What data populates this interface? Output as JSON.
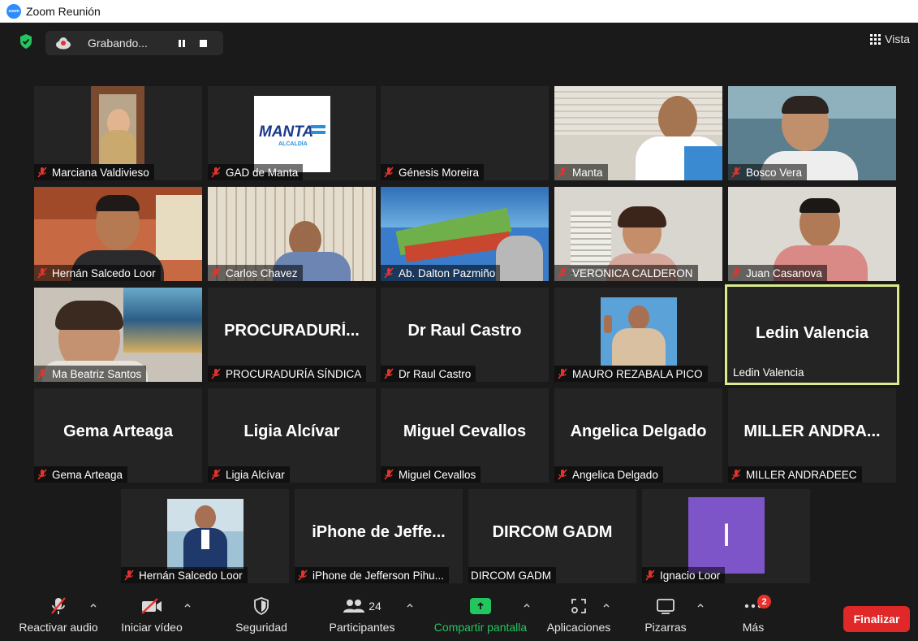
{
  "window": {
    "title": "Zoom Reunión",
    "logo_text": "zoom"
  },
  "recording": {
    "status": "Grabando..."
  },
  "view_button": {
    "label": "Vista"
  },
  "tiles": [
    {
      "label": "Marciana Valdivieso",
      "muted": true
    },
    {
      "label": "GAD de Manta",
      "muted": true,
      "logo_main": "MANTA",
      "logo_sub": "ALCALDÍA"
    },
    {
      "label": "Génesis Moreira",
      "muted": true
    },
    {
      "label": "Manta",
      "muted": true
    },
    {
      "label": "Bosco Vera",
      "muted": true
    },
    {
      "label": "Hernán Salcedo Loor",
      "muted": true
    },
    {
      "label": "Carlos Chavez",
      "muted": true
    },
    {
      "label": "Ab. Dalton Pazmiño",
      "muted": true
    },
    {
      "label": "VERONICA CALDERON",
      "muted": true
    },
    {
      "label": "Juan Casanova",
      "muted": true
    },
    {
      "label": "Ma Beatriz Santos",
      "muted": true
    },
    {
      "big": "PROCURADURÍ...",
      "label": "PROCURADURÍA SÍNDICA",
      "muted": true
    },
    {
      "big": "Dr Raul Castro",
      "label": "Dr Raul Castro",
      "muted": true
    },
    {
      "label": "MAURO REZABALA PICO",
      "muted": true
    },
    {
      "big": "Ledin Valencia",
      "label": "Ledin Valencia",
      "muted": false,
      "active": true
    },
    {
      "big": "Gema Arteaga",
      "label": "Gema Arteaga",
      "muted": true
    },
    {
      "big": "Ligia Alcívar",
      "label": "Ligia Alcívar",
      "muted": true
    },
    {
      "big": "Miguel Cevallos",
      "label": "Miguel Cevallos",
      "muted": true
    },
    {
      "big": "Angelica Delgado",
      "label": "Angelica Delgado",
      "muted": true
    },
    {
      "big": "MILLER ANDRA...",
      "label": "MILLER ANDRADEEC",
      "muted": true
    },
    {
      "label": "Hernán Salcedo Loor",
      "muted": true
    },
    {
      "big": "iPhone de Jeffe...",
      "label": "iPhone de Jefferson Pihu...",
      "muted": true
    },
    {
      "big": "DIRCOM GADM",
      "label": "DIRCOM GADM",
      "muted": false
    },
    {
      "label": "Ignacio Loor",
      "muted": true,
      "avatar_letter": "I"
    }
  ],
  "toolbar": {
    "audio": "Reactivar audio",
    "video": "Iniciar vídeo",
    "security": "Seguridad",
    "participants": "Participantes",
    "participants_count": "24",
    "share": "Compartir pantalla",
    "apps": "Aplicaciones",
    "whiteboards": "Pizarras",
    "more": "Más",
    "more_badge": "2",
    "end": "Finalizar"
  },
  "colors": {
    "active_border": "#d9ec8a",
    "share_green": "#22c55e",
    "end_red": "#e02828",
    "mute_red": "#e5322d",
    "avatar_purple": "#7e55c9"
  }
}
